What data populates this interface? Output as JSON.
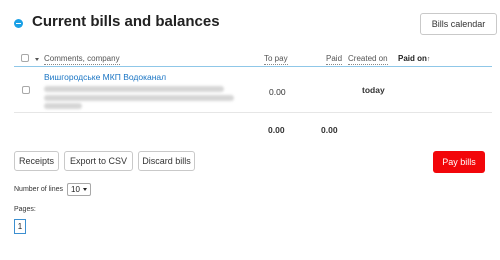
{
  "header": {
    "title": "Current bills and balances",
    "calendar_button": "Bills calendar"
  },
  "table": {
    "columns": {
      "comments": "Comments, company",
      "to_pay": "To pay",
      "paid": "Paid",
      "created_on": "Created on",
      "paid_on": "Paid on",
      "paid_on_sort": "↑"
    },
    "rows": [
      {
        "company": "Вишгородське МКП Водоканал",
        "to_pay": "0.00",
        "paid": "",
        "created_on": "",
        "paid_on": "today"
      }
    ],
    "totals": {
      "to_pay": "0.00",
      "paid": "0.00"
    }
  },
  "actions": {
    "receipts": "Receipts",
    "export_csv": "Export to CSV",
    "discard_bills": "Discard bills",
    "pay_bills": "Pay bills"
  },
  "pagination": {
    "lines_label": "Number of lines",
    "lines_value": "10",
    "pages_label": "Pages:",
    "current_page": "1"
  },
  "colors": {
    "accent": "#1aa0e6",
    "link": "#1a75c4",
    "pay_button": "#f2060a"
  }
}
